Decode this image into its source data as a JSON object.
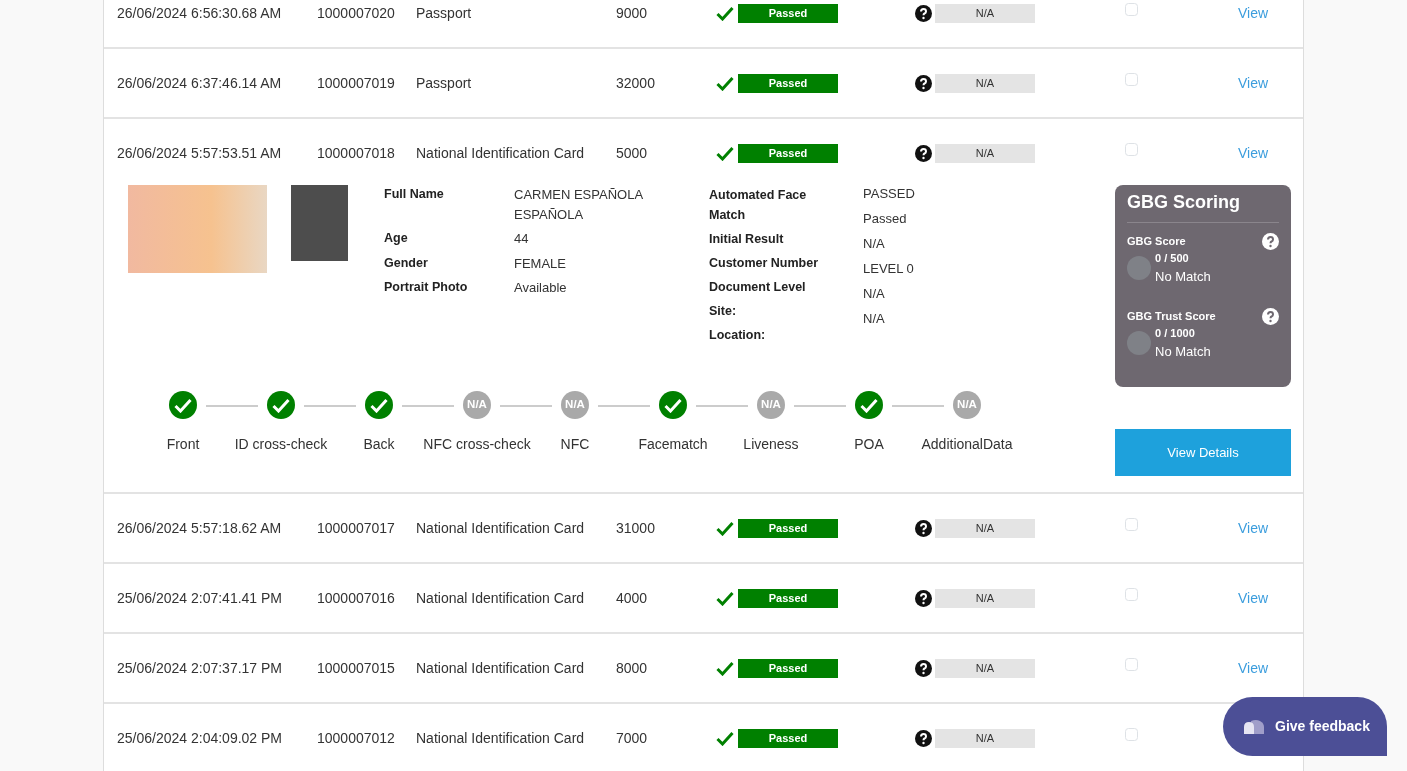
{
  "rows": [
    {
      "date": "26/06/2024 6:56:30.68 AM",
      "id": "1000007020",
      "document": "Passport",
      "amount": "9000",
      "result": {
        "kind": "passed",
        "label": "Passed"
      },
      "alert": {
        "kind": "unknown",
        "label": "N/A"
      },
      "checked": false,
      "action": "View"
    },
    {
      "date": "26/06/2024 6:37:46.14 AM",
      "id": "1000007019",
      "document": "Passport",
      "amount": "32000",
      "result": {
        "kind": "passed",
        "label": "Passed"
      },
      "alert": {
        "kind": "unknown",
        "label": "N/A"
      },
      "checked": false,
      "action": "View"
    },
    {
      "date": "26/06/2024 5:57:53.51 AM",
      "id": "1000007018",
      "document": "National Identification Card",
      "amount": "5000",
      "result": {
        "kind": "passed",
        "label": "Passed"
      },
      "alert": {
        "kind": "unknown",
        "label": "N/A"
      },
      "checked": false,
      "action": "View",
      "details": {
        "fields": [
          {
            "label": "Full Name",
            "value": "CARMEN ESPAÑOLA ESPAÑOLA"
          },
          {
            "label": "Age",
            "value": "44"
          },
          {
            "label": "Gender",
            "value": "FEMALE"
          },
          {
            "label": "Portrait Photo",
            "value": "Available"
          }
        ],
        "extra_labels": [
          "Automated Face Match",
          "Initial Result",
          "Customer Number",
          "Document Level",
          "Site:",
          "Location:"
        ],
        "extra_values": [
          "PASSED",
          "Passed",
          "N/A",
          "LEVEL 0",
          "N/A",
          "N/A"
        ],
        "steps": [
          {
            "label": "Front",
            "kind": "passed"
          },
          {
            "label": "ID cross-check",
            "kind": "passed"
          },
          {
            "label": "Back",
            "kind": "passed"
          },
          {
            "label": "NFC cross-check",
            "kind": "na",
            "badge": "N/A"
          },
          {
            "label": "NFC",
            "kind": "na",
            "badge": "N/A"
          },
          {
            "label": "Facematch",
            "kind": "passed"
          },
          {
            "label": "Liveness",
            "kind": "na",
            "badge": "N/A"
          },
          {
            "label": "POA",
            "kind": "passed"
          },
          {
            "label": "AdditionalData",
            "kind": "na",
            "badge": "N/A"
          }
        ],
        "scoring": {
          "title": "GBG Scoring",
          "scores": [
            {
              "label": "GBG Score",
              "value": "0 / 500",
              "result": "No Match"
            },
            {
              "label": "GBG Trust Score",
              "value": "0 / 1000",
              "result": "No Match"
            }
          ]
        },
        "details_button": "View Details"
      }
    },
    {
      "date": "26/06/2024 5:57:18.62 AM",
      "id": "1000007017",
      "document": "National Identification Card",
      "amount": "31000",
      "result": {
        "kind": "passed",
        "label": "Passed"
      },
      "alert": {
        "kind": "unknown",
        "label": "N/A"
      },
      "checked": false,
      "action": "View"
    },
    {
      "date": "25/06/2024 2:07:41.41 PM",
      "id": "1000007016",
      "document": "National Identification Card",
      "amount": "4000",
      "result": {
        "kind": "passed",
        "label": "Passed"
      },
      "alert": {
        "kind": "unknown",
        "label": "N/A"
      },
      "checked": false,
      "action": "View"
    },
    {
      "date": "25/06/2024 2:07:37.17 PM",
      "id": "1000007015",
      "document": "National Identification Card",
      "amount": "8000",
      "result": {
        "kind": "passed",
        "label": "Passed"
      },
      "alert": {
        "kind": "unknown",
        "label": "N/A"
      },
      "checked": false,
      "action": "View"
    },
    {
      "date": "25/06/2024 2:04:09.02 PM",
      "id": "1000007012",
      "document": "National Identification Card",
      "amount": "7000",
      "result": {
        "kind": "passed",
        "label": "Passed"
      },
      "alert": {
        "kind": "unknown",
        "label": "N/A"
      },
      "checked": false
    }
  ],
  "feedback_button": "Give feedback"
}
